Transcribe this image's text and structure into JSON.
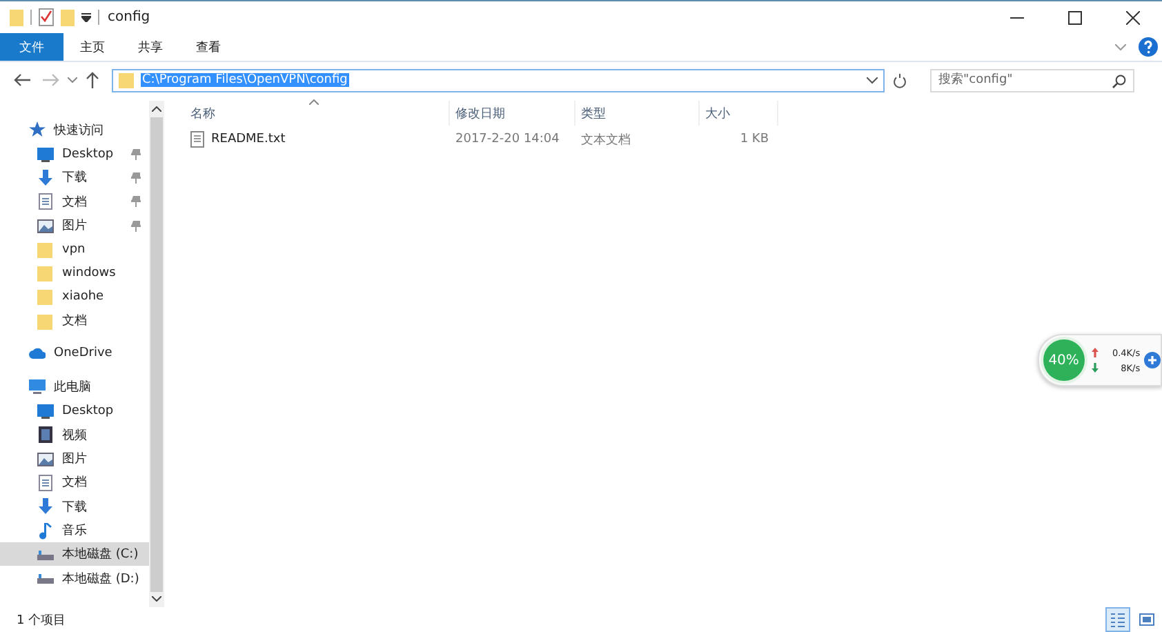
{
  "window": {
    "title": "config"
  },
  "ribbon_tabs": [
    {
      "label": "文件",
      "selected": true
    },
    {
      "label": "主页",
      "selected": false
    },
    {
      "label": "共享",
      "selected": false
    },
    {
      "label": "查看",
      "selected": false
    }
  ],
  "address": {
    "value": "C:\\Program Files\\OpenVPN\\config"
  },
  "search": {
    "placeholder": "搜索\"config\""
  },
  "sidebar": {
    "items": [
      {
        "label": "快速访问",
        "kind": "star",
        "selected": false,
        "children": [
          {
            "label": "Desktop",
            "kind": "desktop",
            "pinned": true,
            "selected": false
          },
          {
            "label": "下载",
            "kind": "download",
            "pinned": true,
            "selected": false
          },
          {
            "label": "文档",
            "kind": "document",
            "pinned": true,
            "selected": false
          },
          {
            "label": "图片",
            "kind": "picture",
            "pinned": true,
            "selected": false
          },
          {
            "label": "vpn",
            "kind": "folder",
            "pinned": false,
            "selected": false
          },
          {
            "label": "windows",
            "kind": "folder",
            "pinned": false,
            "selected": false
          },
          {
            "label": "xiaohe",
            "kind": "folder",
            "pinned": false,
            "selected": false
          },
          {
            "label": "文档",
            "kind": "folder",
            "pinned": false,
            "selected": false
          }
        ]
      },
      {
        "label": "OneDrive",
        "kind": "cloud",
        "selected": false
      },
      {
        "label": "此电脑",
        "kind": "pc",
        "selected": false,
        "children": [
          {
            "label": "Desktop",
            "kind": "desktop",
            "pinned": false,
            "selected": false
          },
          {
            "label": "视频",
            "kind": "video",
            "pinned": false,
            "selected": false
          },
          {
            "label": "图片",
            "kind": "picture",
            "pinned": false,
            "selected": false
          },
          {
            "label": "文档",
            "kind": "document",
            "pinned": false,
            "selected": false
          },
          {
            "label": "下载",
            "kind": "download",
            "pinned": false,
            "selected": false
          },
          {
            "label": "音乐",
            "kind": "music",
            "pinned": false,
            "selected": false
          },
          {
            "label": "本地磁盘 (C:)",
            "kind": "drive",
            "pinned": false,
            "selected": true
          },
          {
            "label": "本地磁盘 (D:)",
            "kind": "drive",
            "pinned": false,
            "selected": false
          }
        ]
      }
    ]
  },
  "table": {
    "columns": [
      "名称",
      "修改日期",
      "类型",
      "大小"
    ],
    "rows": [
      {
        "name": "README.txt",
        "modified": "2017-2-20 14:04",
        "type": "文本文档",
        "size": "1 KB"
      }
    ]
  },
  "speed_widget": {
    "percent": "40%",
    "upload": "0.4K/s",
    "download": "8K/s"
  },
  "status_bar": {
    "text": "1 个项目"
  }
}
